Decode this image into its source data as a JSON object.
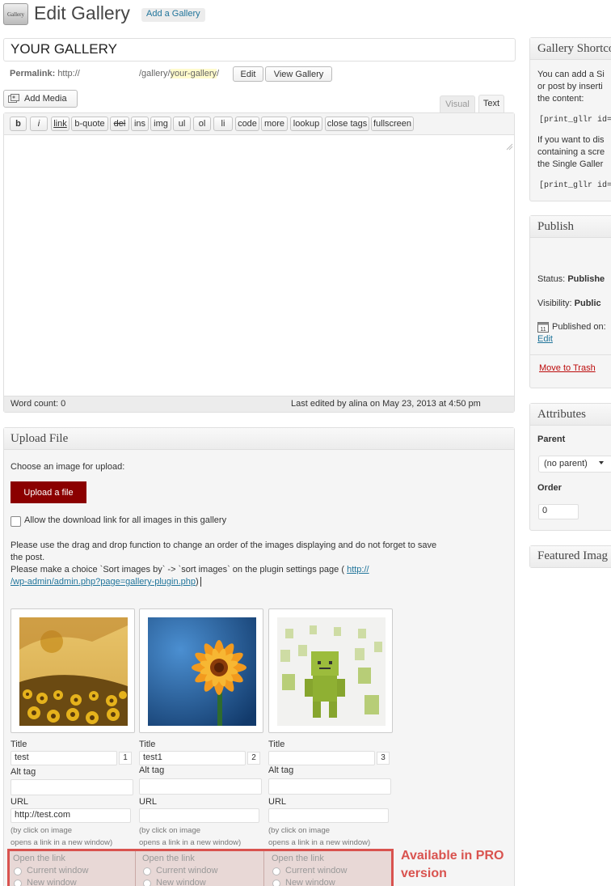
{
  "header": {
    "plugin_icon_label": "Gallery",
    "title": "Edit Gallery",
    "add_button": "Add a Gallery"
  },
  "post": {
    "title_value": "YOUR GALLERY",
    "permalink_label": "Permalink:",
    "permalink_prefix": "http://",
    "permalink_path": "/gallery/",
    "permalink_slug": "your-gallery",
    "permalink_suffix": "/",
    "edit_button": "Edit",
    "view_button": "View Gallery"
  },
  "editor": {
    "add_media": "Add Media",
    "tab_visual": "Visual",
    "tab_text": "Text",
    "quicktags": [
      "b",
      "i",
      "link",
      "b-quote",
      "del",
      "ins",
      "img",
      "ul",
      "ol",
      "li",
      "code",
      "more",
      "lookup",
      "close tags",
      "fullscreen"
    ],
    "word_count": "Word count: 0",
    "last_edited": "Last edited by alina on May 23, 2013 at 4:50 pm"
  },
  "upload": {
    "title": "Upload File",
    "choose_text": "Choose an image for upload:",
    "upload_button": "Upload a file",
    "allow_download": "Allow the download link for all images in this gallery",
    "instructions_1": "Please use the drag and drop function to change an order of the images displaying and do not forget to save",
    "instructions_1b": "the post.",
    "instructions_2": "Please make a choice `Sort images by` -> `sort images` on the plugin settings page (",
    "settings_link_1": "http://",
    "settings_link_2": "/wp-admin/admin.php?page=gallery-plugin.php",
    "instructions_2_end": ")"
  },
  "images": [
    {
      "name": "sunflowers",
      "title_label": "Title",
      "title_value": "test",
      "order": "1",
      "alt_label": "Alt tag",
      "alt_value": "",
      "url_label": "URL",
      "url_value": "http://test.com",
      "hint_1": "(by click on image",
      "hint_2": "opens a link in a new window)",
      "open_link": "Open the link",
      "current_window": "Current window",
      "new_window": "New window"
    },
    {
      "name": "orange-flower",
      "title_label": "Title",
      "title_value": "test1",
      "order": "2",
      "alt_label": "Alt tag",
      "alt_value": "",
      "url_label": "URL",
      "url_value": "",
      "hint_1": "(by click on image",
      "hint_2": "opens a link in a new window)",
      "open_link": "Open the link",
      "current_window": "Current window",
      "new_window": "New window"
    },
    {
      "name": "green-robots",
      "title_label": "Title",
      "title_value": "",
      "order": "3",
      "alt_label": "Alt tag",
      "alt_value": "",
      "url_label": "URL",
      "url_value": "",
      "hint_1": "(by click on image",
      "hint_2": "opens a link in a new window)",
      "open_link": "Open the link",
      "current_window": "Current window",
      "new_window": "New window"
    }
  ],
  "pro_notice": {
    "line1": "Available in PRO",
    "line2": "version",
    "color": "#d9534f"
  },
  "sidebar": {
    "shortcode": {
      "title": "Gallery Shortco",
      "text_1": "You can add a Si",
      "text_2": "or post by inserti",
      "text_3": "the content:",
      "code_1": "[print_gllr id=",
      "text_4": "If you want to dis",
      "text_5": "containing a scre",
      "text_6": "the Single Galler",
      "code_2": "[print_gllr id="
    },
    "publish": {
      "title": "Publish",
      "status_label": "Status:",
      "status_value": "Publishe",
      "visibility_label": "Visibility:",
      "visibility_value": "Public",
      "published_on": "Published on:",
      "edit_link": "Edit",
      "trash_link": "Move to Trash"
    },
    "attributes": {
      "title": "Attributes",
      "parent_label": "Parent",
      "parent_value": "(no parent)",
      "order_label": "Order",
      "order_value": "0"
    },
    "featured": {
      "title": "Featured Imag"
    }
  },
  "colors": {
    "upload_button_bg": "#8b0000",
    "link": "#21759b",
    "trash": "#bc0b0b",
    "slug_highlight": "#fffbcc",
    "pro_border": "#d9534f"
  }
}
